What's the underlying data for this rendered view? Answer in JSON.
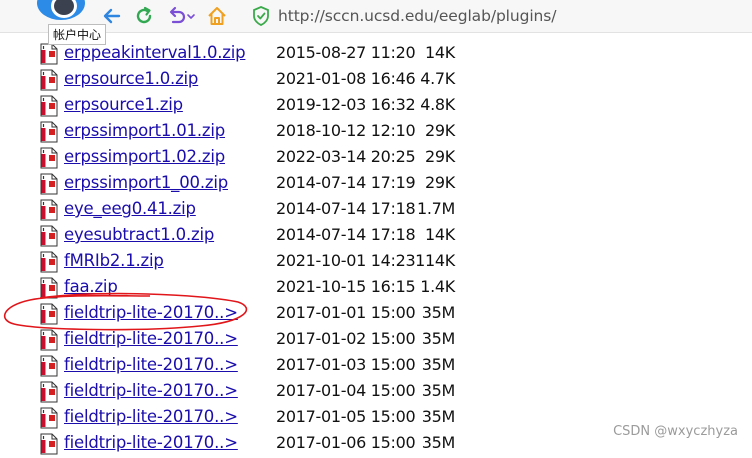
{
  "browser": {
    "tooltip": "帐户中心",
    "url": "http://sccn.ucsd.edu/eeglab/plugins/"
  },
  "files": [
    {
      "name": "erppeakinterval1.0.zip",
      "date": "2015-08-27 11:20",
      "size": "14K"
    },
    {
      "name": "erpsource1.0.zip",
      "date": "2021-01-08 16:46",
      "size": "4.7K"
    },
    {
      "name": "erpsource1.zip",
      "date": "2019-12-03 16:32",
      "size": "4.8K"
    },
    {
      "name": "erpssimport1.01.zip",
      "date": "2018-10-12 12:10",
      "size": "29K"
    },
    {
      "name": "erpssimport1.02.zip",
      "date": "2022-03-14 20:25",
      "size": "29K"
    },
    {
      "name": "erpssimport1_00.zip",
      "date": "2014-07-14 17:19",
      "size": "29K"
    },
    {
      "name": "eye_eeg0.41.zip",
      "date": "2014-07-14 17:18",
      "size": "1.7M"
    },
    {
      "name": "eyesubtract1.0.zip",
      "date": "2014-07-14 17:18",
      "size": "14K"
    },
    {
      "name": "fMRIb2.1.zip",
      "date": "2021-10-01 14:23",
      "size": "114K"
    },
    {
      "name": "faa.zip",
      "date": "2021-10-15 16:15",
      "size": "1.4K"
    },
    {
      "name": "fieldtrip-lite-20170..>",
      "date": "2017-01-01 15:00",
      "size": "35M"
    },
    {
      "name": "fieldtrip-lite-20170..>",
      "date": "2017-01-02 15:00",
      "size": "35M"
    },
    {
      "name": "fieldtrip-lite-20170..>",
      "date": "2017-01-03 15:00",
      "size": "35M"
    },
    {
      "name": "fieldtrip-lite-20170..>",
      "date": "2017-01-04 15:00",
      "size": "35M"
    },
    {
      "name": "fieldtrip-lite-20170..>",
      "date": "2017-01-05 15:00",
      "size": "35M"
    },
    {
      "name": "fieldtrip-lite-20170..>",
      "date": "2017-01-06 15:00",
      "size": "35M"
    }
  ],
  "highlighted_row": 10,
  "watermark": "CSDN @wxyczhyza",
  "colors": {
    "link": "#1a0dab",
    "back": "#2f86e0",
    "refresh": "#33a852",
    "undo": "#7a4fd6",
    "home": "#f0a020",
    "shield": "#3aaa4a",
    "annotation": "#e0161b"
  }
}
